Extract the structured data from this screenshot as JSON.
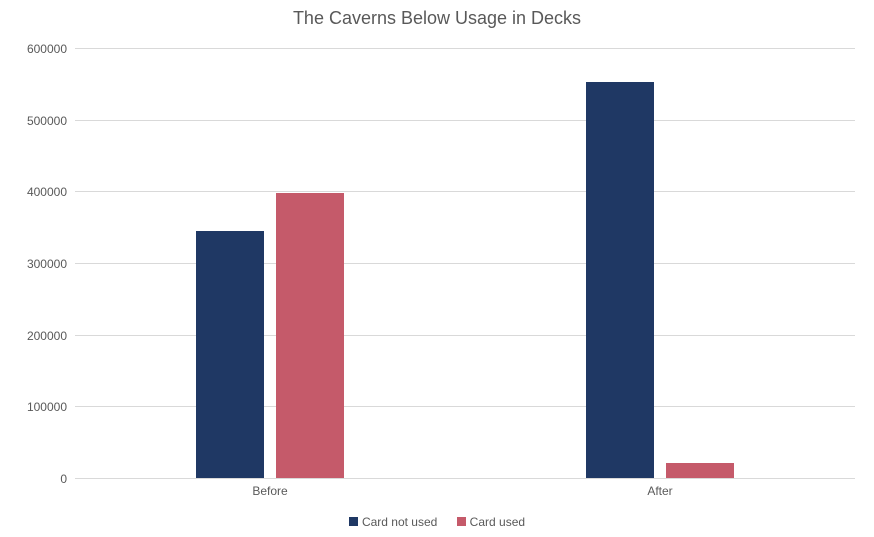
{
  "chart_data": {
    "type": "bar",
    "title": "The Caverns Below Usage in Decks",
    "categories": [
      "Before",
      "After"
    ],
    "series": [
      {
        "name": "Card not used",
        "values": [
          345000,
          553000
        ],
        "color": "#1f3864"
      },
      {
        "name": "Card used",
        "values": [
          398000,
          21000
        ],
        "color": "#c55a6a"
      }
    ],
    "xlabel": "",
    "ylabel": "",
    "ylim": [
      0,
      600000
    ],
    "yticks": [
      0,
      100000,
      200000,
      300000,
      400000,
      500000,
      600000
    ],
    "grid": true,
    "legend_position": "bottom"
  }
}
